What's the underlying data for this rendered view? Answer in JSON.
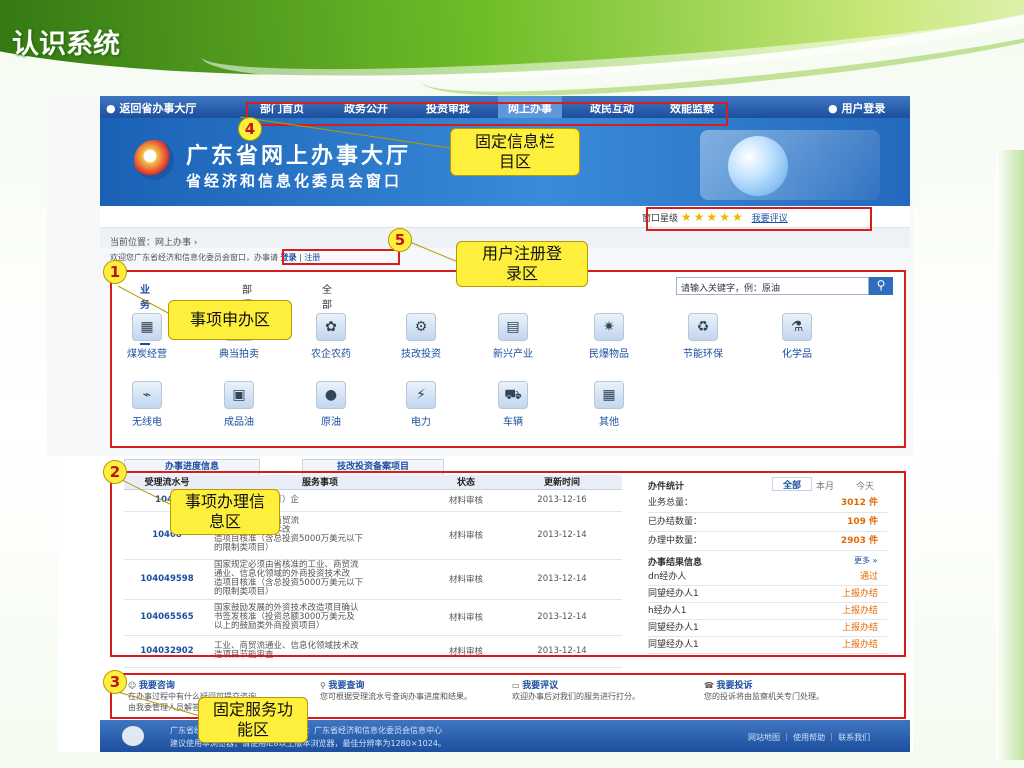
{
  "slide_title": "认识系统",
  "top_nav": {
    "back_label": "返回省办事大厅",
    "items": [
      "部门首页",
      "政务公开",
      "投资审批",
      "网上办事",
      "政民互动",
      "效能监察"
    ],
    "login_label": "用户登录"
  },
  "banner": {
    "title_line1": "广东省网上办事大厅",
    "title_line2": "省经济和信息化委员会窗口"
  },
  "rating": {
    "label": "窗口星级",
    "stars": 5,
    "review_link": "我要评议"
  },
  "breadcrumb": "当前位置：网上办事 ›",
  "welcome": {
    "text": "欢迎您广东省经济和信息化委员会窗口，办事请",
    "login": "登录",
    "register": "注册"
  },
  "business": {
    "tabs": [
      "业务办事",
      "部门办事",
      "全部事项"
    ],
    "search_placeholder": "请输入关键字，例：原油",
    "tiles_row1": [
      "煤炭经营",
      "典当拍卖",
      "农企农药",
      "技改投资",
      "新兴产业",
      "民爆物品",
      "节能环保",
      "化学品"
    ],
    "tiles_row2": [
      "无线电",
      "成品油",
      "原油",
      "电力",
      "车辆",
      "其他"
    ]
  },
  "info": {
    "tabs": [
      "办事进度信息",
      "技改投资备案项目"
    ],
    "headers": [
      "受理流水号",
      "服务事项",
      "状态",
      "更新时间"
    ],
    "rows": [
      {
        "id": "1040",
        "item": "兴产业骨干（培育）企",
        "status": "材料审核",
        "time": "2013-12-16"
      },
      {
        "id": "10408",
        "item": "省核准的工业、商贸流\n域的外商投资技术改\n造项目核准（含总投资5000万美元以下\n的限制类项目）",
        "status": "材料审核",
        "time": "2013-12-14"
      },
      {
        "id": "104049598",
        "item": "国家规定必须由省核准的工业、商贸流\n通业、信息化领域的外商投资技术改\n造项目核准（含总投资5000万美元以下\n的限制类项目）",
        "status": "材料审核",
        "time": "2013-12-14"
      },
      {
        "id": "104065565",
        "item": "国家鼓励发展的外资技术改造项目确认\n书签发核准（投资总额3000万美元及\n以上的鼓励类外商投资项目）",
        "status": "材料审核",
        "time": "2013-12-14"
      },
      {
        "id": "104032902",
        "item": "工业、商贸流通业、信息化领域技术改\n造项目节能审查",
        "status": "材料审核",
        "time": "2013-12-14"
      }
    ]
  },
  "stats": {
    "title": "办件统计",
    "tabs": [
      "全部",
      "本月",
      "今天"
    ],
    "rows": [
      {
        "label": "业务总量：",
        "value": "3012 件"
      },
      {
        "label": "已办结数量：",
        "value": "109 件"
      },
      {
        "label": "办理中数量：",
        "value": "2903 件"
      }
    ],
    "result_title": "办事结果信息",
    "more": "更多 »",
    "results": [
      {
        "who": "dn经办人",
        "status": "通过"
      },
      {
        "who": "同望经办人1",
        "status": "上报办结"
      },
      {
        "who": "h经办人1",
        "status": "上报办结"
      },
      {
        "who": "同望经办人1",
        "status": "上报办结"
      },
      {
        "who": "同望经办人1",
        "status": "上报办结"
      }
    ]
  },
  "services": [
    {
      "title": "我要咨询",
      "desc": "在办事过程中有什么疑问可提交咨询，\n由我委管理人员解答。"
    },
    {
      "title": "我要查询",
      "desc": "您可根据受理流水号查询办事进度和结果。"
    },
    {
      "title": "我要评议",
      "desc": "欢迎办事后对我们的服务进行打分。"
    },
    {
      "title": "我要投诉",
      "desc": "您的投诉将由监察机关专门处理。"
    }
  ],
  "footer": {
    "line1": "广东省经济和信息化委员会　建设单位：广东省经济和信息化委员会信息中心",
    "line2": "建议使用本浏览器，请使用IE8以上版本浏览器，最佳分辨率为1280×1024。",
    "links": "网站地图 ｜ 使用帮助 ｜ 联系我们"
  },
  "annotations": [
    {
      "num": "1",
      "label": "事项申办区"
    },
    {
      "num": "2",
      "label": "事项办理信\n息区"
    },
    {
      "num": "3",
      "label": "固定服务功\n能区"
    },
    {
      "num": "4",
      "label": "固定信息栏\n目区"
    },
    {
      "num": "5",
      "label": "用户注册登\n录区"
    }
  ],
  "colors": {
    "accent_blue": "#1d4fa0",
    "annotation_red": "#d71c1c",
    "callout_yellow": "#ffef3d"
  }
}
